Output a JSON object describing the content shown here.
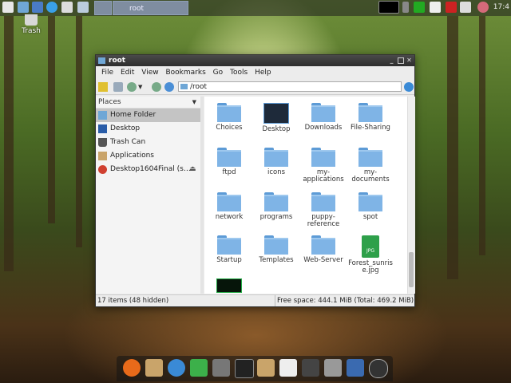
{
  "desktop": {
    "trash_label": "Trash"
  },
  "taskbar": {
    "active_task": "root",
    "clock": "17:4"
  },
  "window": {
    "title": "root",
    "menu": [
      "File",
      "Edit",
      "View",
      "Bookmarks",
      "Go",
      "Tools",
      "Help"
    ],
    "path": "/root",
    "places_header": "Places",
    "places": [
      {
        "label": "Home Folder",
        "icon": "home-folder-icon",
        "selected": true
      },
      {
        "label": "Desktop",
        "icon": "desktop-icon"
      },
      {
        "label": "Trash Can",
        "icon": "trash-can-icon"
      },
      {
        "label": "Applications",
        "icon": "applications-icon"
      },
      {
        "label": "Desktop1604Final (s…",
        "icon": "drive-icon"
      }
    ],
    "files": [
      {
        "label": "Choices",
        "icon": "folder-icon"
      },
      {
        "label": "Desktop",
        "icon": "desktop-folder-icon"
      },
      {
        "label": "Downloads",
        "icon": "folder-icon"
      },
      {
        "label": "File-Sharing",
        "icon": "folder-icon"
      },
      {
        "label": "ftpd",
        "icon": "folder-icon"
      },
      {
        "label": "icons",
        "icon": "folder-icon"
      },
      {
        "label": "my-\napplications",
        "icon": "folder-icon"
      },
      {
        "label": "my-\ndocuments",
        "icon": "folder-icon"
      },
      {
        "label": "network",
        "icon": "folder-icon"
      },
      {
        "label": "programs",
        "icon": "folder-icon"
      },
      {
        "label": "puppy-\nreference",
        "icon": "folder-icon"
      },
      {
        "label": "spot",
        "icon": "folder-icon"
      },
      {
        "label": "Startup",
        "icon": "folder-icon"
      },
      {
        "label": "Templates",
        "icon": "folder-icon"
      },
      {
        "label": "Web-Server",
        "icon": "folder-icon"
      },
      {
        "label": "Forest_sunris\ne.jpg",
        "icon": "jpg-file-icon"
      },
      {
        "label": "",
        "icon": "terminal-file-icon"
      }
    ],
    "status_left": "17 items (48 hidden)",
    "status_right": "Free space: 444.1 MiB (Total: 469.2 MiB)"
  },
  "colors": {
    "folder": "#7fb4e6",
    "titlebar": "#3a3a3a",
    "selection": "#c4c4c4"
  }
}
